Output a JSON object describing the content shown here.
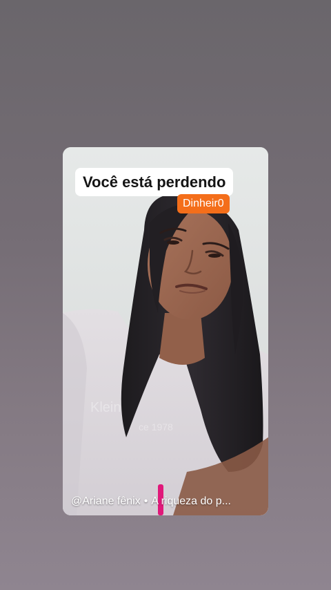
{
  "story": {
    "caption_title": "Você está perdendo",
    "caption_badge": "Dinheir0",
    "attribution": {
      "handle": "@Ariane fênix",
      "separator": "•",
      "title": "A riqueza do p..."
    },
    "photo": {
      "subject": "shirt-print",
      "shirt_text_line1": "Klein",
      "shirt_text_line2": "ce 1978"
    }
  },
  "colors": {
    "badge": "#f46e1a",
    "caption_bg": "#ffffff",
    "background": "#7a727a"
  }
}
